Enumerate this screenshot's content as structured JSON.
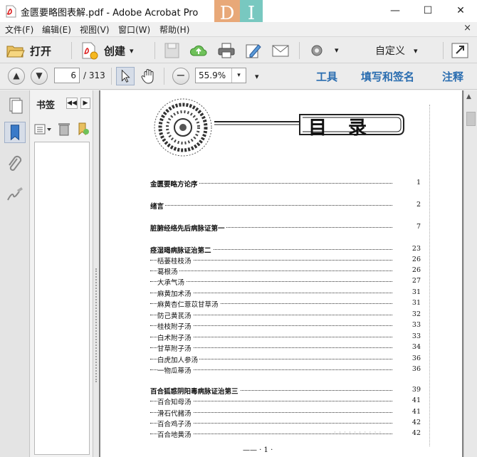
{
  "window": {
    "title": "金匮要略图表解.pdf - Adobe Acrobat Pro",
    "minimize": "—",
    "maximize": "☐",
    "close": "✕",
    "overlay_letters": [
      "D",
      "I"
    ]
  },
  "menu": {
    "items": [
      "文件(F)",
      "编辑(E)",
      "视图(V)",
      "窗口(W)",
      "帮助(H)"
    ],
    "close_doc": "×"
  },
  "toolbar": {
    "open_label": "打开",
    "create_label": "创建",
    "customize_label": "自定义",
    "dropdown_glyph": "▾"
  },
  "navigation": {
    "current_page": "6",
    "total_pages": "/ 313",
    "zoom": "55.9%",
    "tools_label": "工具",
    "fill_sign_label": "填写和签名",
    "comment_label": "注释"
  },
  "bookmarks": {
    "title": "书签"
  },
  "document": {
    "toc_title": "目录",
    "entries": [
      {
        "label": "金匮要略方论序",
        "page": "1",
        "level": "main"
      },
      {
        "label": "绪言",
        "page": "2",
        "level": "main"
      },
      {
        "label": "脏腑经络先后病脉证第一",
        "page": "7",
        "level": "main"
      },
      {
        "label": "痉湿暍病脉证治第二",
        "page": "23",
        "level": "main"
      },
      {
        "label": "栝蒌桂枝汤",
        "page": "26",
        "level": "sub"
      },
      {
        "label": "葛根汤",
        "page": "26",
        "level": "sub"
      },
      {
        "label": "大承气汤",
        "page": "27",
        "level": "sub"
      },
      {
        "label": "麻黄加术汤",
        "page": "31",
        "level": "sub"
      },
      {
        "label": "麻黄杏仁薏苡甘草汤",
        "page": "31",
        "level": "sub"
      },
      {
        "label": "防己黄芪汤",
        "page": "32",
        "level": "sub"
      },
      {
        "label": "桂枝附子汤",
        "page": "33",
        "level": "sub"
      },
      {
        "label": "白术附子汤",
        "page": "33",
        "level": "sub"
      },
      {
        "label": "甘草附子汤",
        "page": "34",
        "level": "sub"
      },
      {
        "label": "白虎加人参汤",
        "page": "36",
        "level": "sub"
      },
      {
        "label": "一物瓜蒂汤",
        "page": "36",
        "level": "sub"
      },
      {
        "label": "百合狐惑阴阳毒病脉证治第三",
        "page": "39",
        "level": "main"
      },
      {
        "label": "百合知母汤",
        "page": "41",
        "level": "sub"
      },
      {
        "label": "滑石代赭汤",
        "page": "41",
        "level": "sub"
      },
      {
        "label": "百合鸡子汤",
        "page": "42",
        "level": "sub"
      },
      {
        "label": "百合地黄汤",
        "page": "42",
        "level": "sub"
      }
    ],
    "footer": "—— · 1 ·"
  },
  "colors": {
    "link_blue": "#2a6db0",
    "overlay_orange": "#e8a878",
    "overlay_teal": "#78c8c0"
  }
}
